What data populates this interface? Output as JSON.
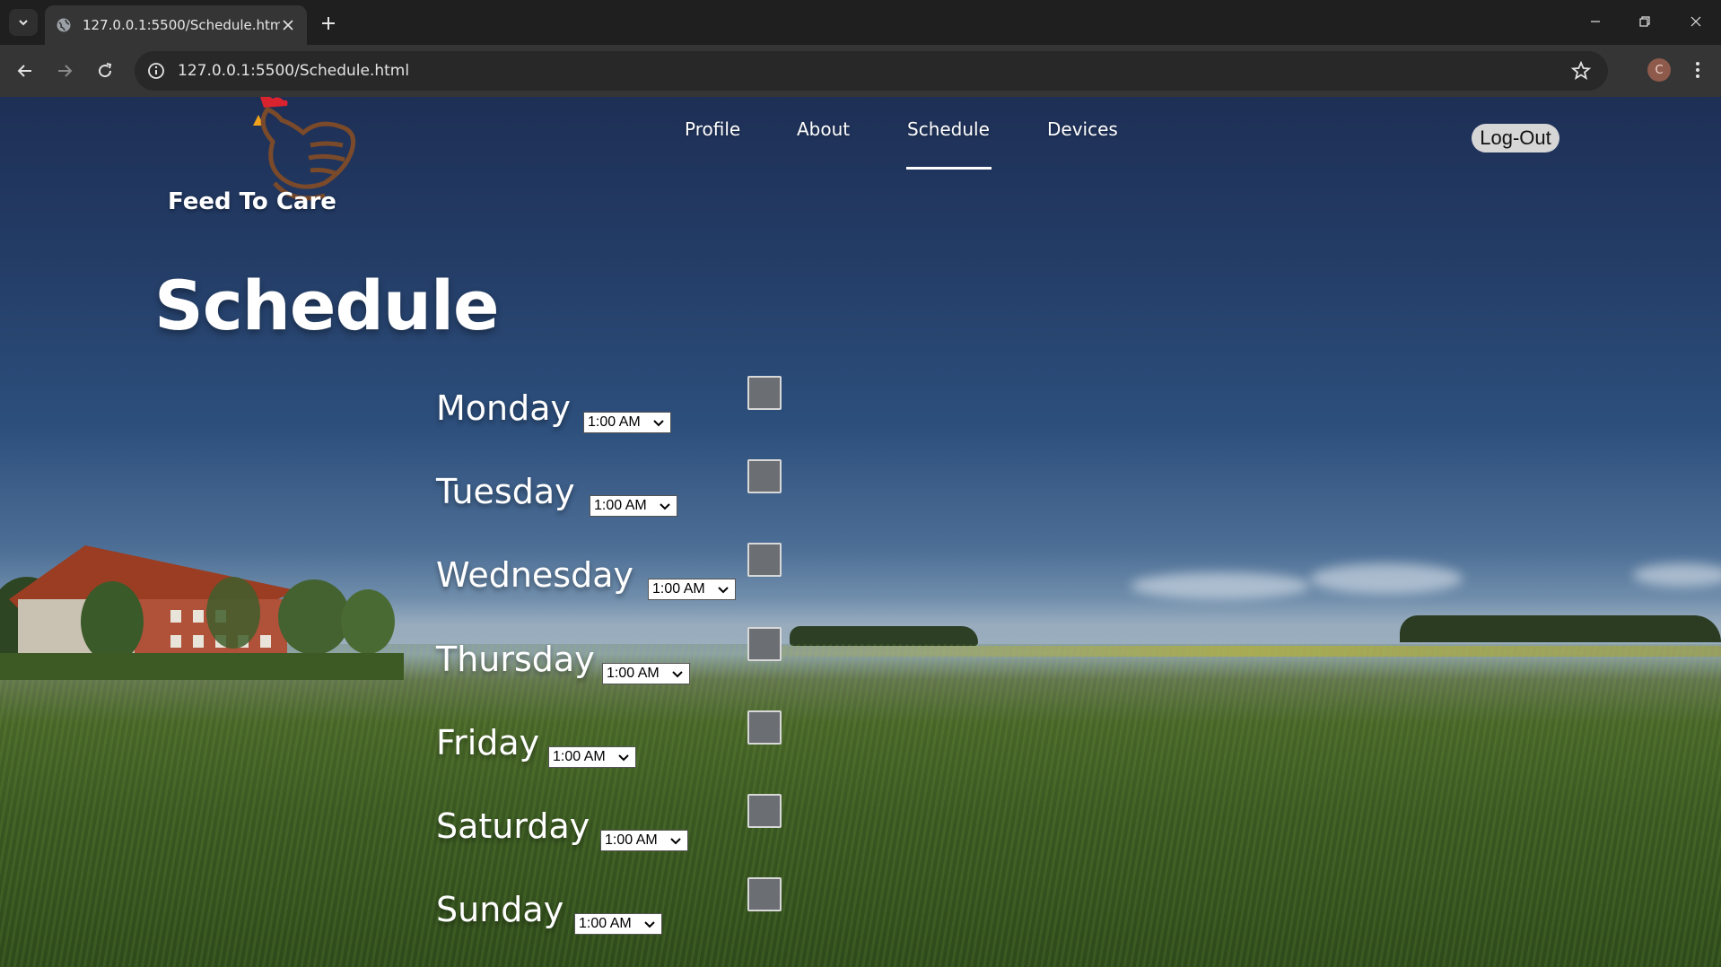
{
  "browser": {
    "tab_title": "127.0.0.1:5500/Schedule.html",
    "url": "127.0.0.1:5500/Schedule.html",
    "profile_initial": "C",
    "icons": {
      "tab_list": "chevron-down-icon",
      "tab_favicon": "globe-icon",
      "tab_close": "close-icon",
      "new_tab": "plus-icon",
      "minimize": "minimize-icon",
      "restore": "restore-icon",
      "close_window": "close-icon",
      "back": "arrow-left-icon",
      "forward": "arrow-right-icon",
      "reload": "reload-icon",
      "site_info": "info-icon",
      "bookmark": "star-icon",
      "menu": "kebab-icon"
    }
  },
  "site": {
    "brand": "Feed To Care",
    "nav": [
      {
        "label": "Profile"
      },
      {
        "label": "About"
      },
      {
        "label": "Schedule",
        "active": true
      },
      {
        "label": "Devices"
      }
    ],
    "logout_label": "Log-Out"
  },
  "page": {
    "title": "Schedule",
    "rows": [
      {
        "day": "Monday",
        "time": "1:00 AM",
        "checked": false
      },
      {
        "day": "Tuesday",
        "time": "1:00 AM",
        "checked": false
      },
      {
        "day": "Wednesday",
        "time": "1:00 AM",
        "checked": false
      },
      {
        "day": "Thursday",
        "time": "1:00 AM",
        "checked": false
      },
      {
        "day": "Friday",
        "time": "1:00 AM",
        "checked": false
      },
      {
        "day": "Saturday",
        "time": "1:00 AM",
        "checked": false
      },
      {
        "day": "Sunday",
        "time": "1:00 AM",
        "checked": false
      }
    ]
  },
  "colors": {
    "chrome_bg": "#1f1f1f",
    "toolbar_bg": "#353535",
    "nav_active_underline": "#ffffff",
    "checkbox_fill": "#6b6e72",
    "logout_bg": "#d6d6d6"
  }
}
